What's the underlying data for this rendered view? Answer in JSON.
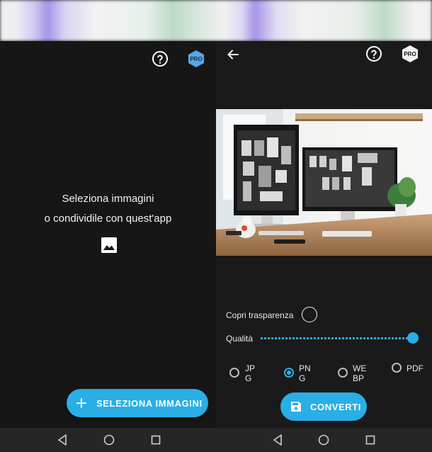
{
  "left_screen": {
    "message_line1": "Seleziona immagini",
    "message_line2": "o condividile con quest'app",
    "fab_label": "SELEZIONA IMMAGINI",
    "pro_badge": "PRO"
  },
  "right_screen": {
    "pro_badge": "PRO",
    "transparency_label": "Copri trasparenza",
    "quality_label": "Qualità",
    "quality_value": 1.0,
    "formats": [
      {
        "label": "JPG",
        "selected": false
      },
      {
        "label": "PNG",
        "selected": true
      },
      {
        "label": "WEBP",
        "selected": false
      },
      {
        "label": "PDF",
        "selected": false
      }
    ],
    "convert_label": "CONVERTI"
  },
  "colors": {
    "accent": "#2aaee6",
    "background": "#161616",
    "navbar": "#262626",
    "pro_badge": "#5aa6e8"
  }
}
